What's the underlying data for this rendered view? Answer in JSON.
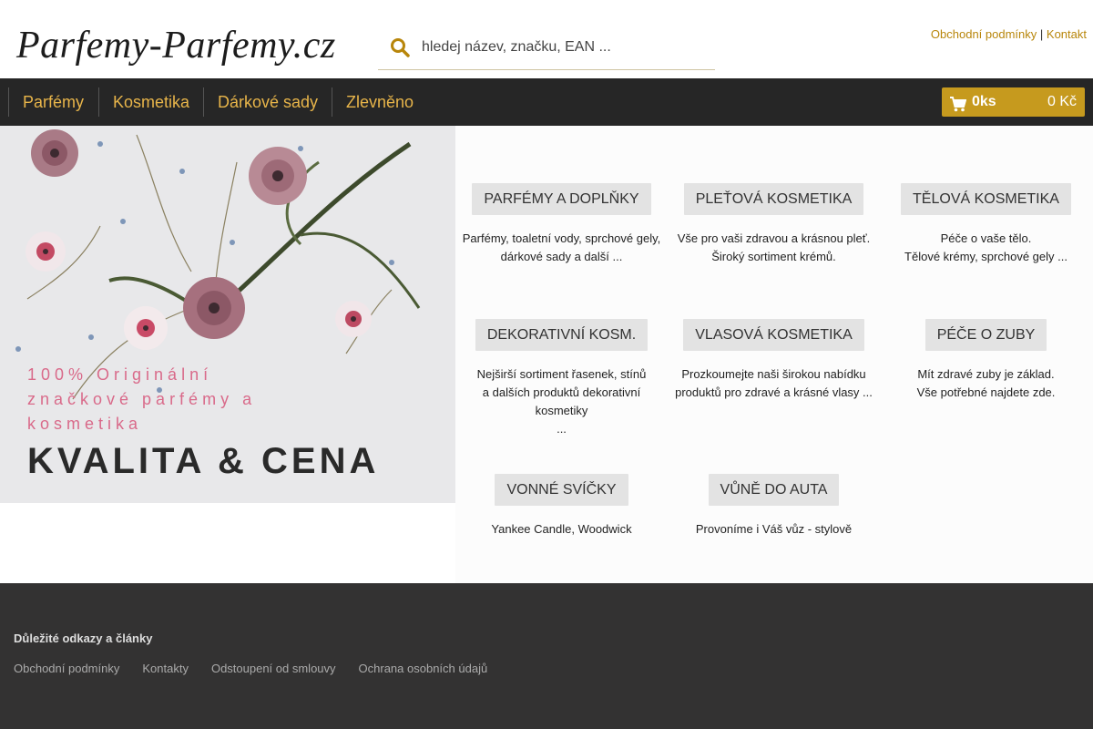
{
  "header": {
    "logo_text": "Parfemy-Parfemy.cz",
    "search_placeholder": "hledej název, značku, EAN ...",
    "links": [
      "Obchodní podmínky",
      "Kontakt"
    ],
    "link_separator": "|"
  },
  "nav": {
    "items": [
      "Parfémy",
      "Kosmetika",
      "Dárkové sady",
      "Zlevněno"
    ]
  },
  "cart": {
    "count": "0ks",
    "price": "0 Kč"
  },
  "hero": {
    "tagline_lines": [
      "100% Originální",
      "značkové parfémy a",
      "kosmetika"
    ],
    "title": "KVALITA & CENA"
  },
  "categories": [
    {
      "title": "PARFÉMY A DOPLŇKY",
      "desc_lines": [
        "Parfémy, toaletní vody, sprchové gely,",
        "dárkové sady a další ..."
      ]
    },
    {
      "title": "PLEŤOVÁ KOSMETIKA",
      "desc_lines": [
        "Vše pro vaši zdravou a krásnou pleť.",
        "Široký sortiment krémů."
      ]
    },
    {
      "title": "TĚLOVÁ KOSMETIKA",
      "desc_lines": [
        "Péče o vaše tělo.",
        "Tělové krémy, sprchové gely ..."
      ]
    },
    {
      "title": "DEKORATIVNÍ KOSM.",
      "desc_lines": [
        "Nejširší sortiment řasenek, stínů",
        "a dalších produktů dekorativní kosmetiky",
        "..."
      ]
    },
    {
      "title": "VLASOVÁ KOSMETIKA",
      "desc_lines": [
        "Prozkoumejte naši širokou nabídku",
        "produktů pro zdravé a krásné vlasy ..."
      ]
    },
    {
      "title": "PÉČE O ZUBY",
      "desc_lines": [
        "Mít zdravé zuby je základ.",
        "Vše potřebné najdete zde."
      ]
    },
    {
      "title": "VONNÉ SVÍČKY",
      "desc_lines": [
        "Yankee Candle, Woodwick"
      ]
    },
    {
      "title": "VŮNĚ DO AUTA",
      "desc_lines": [
        "Provoníme i Váš vůz - stylově"
      ]
    }
  ],
  "footer": {
    "heading": "Důležité odkazy a články",
    "links": [
      "Obchodní podmínky",
      "Kontakty",
      "Odstoupení od smlouvy",
      "Ochrana osobních údajů"
    ]
  },
  "colors": {
    "accent": "#c69a1e",
    "nav_text": "#e8b54a",
    "nav_bg": "#262626",
    "footer_bg": "#333232",
    "tagline": "#d96a8a"
  },
  "icons": {
    "search": "search-icon",
    "cart": "cart-icon"
  }
}
